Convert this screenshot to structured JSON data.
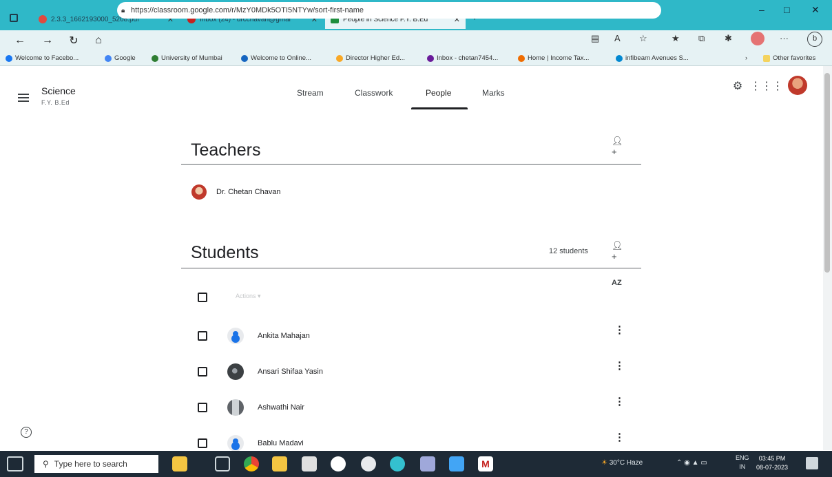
{
  "browser": {
    "tabs": [
      {
        "title": "2.3.3_1662193000_5208.pdf",
        "color": "#e04a3f",
        "active": false
      },
      {
        "title": "Inbox (24) - drcchavan@gmai",
        "color": "#c5221f",
        "active": false
      },
      {
        "title": "People in Science F.Y. B.Ed",
        "color": "#1e8e3e",
        "active": true
      }
    ],
    "new_tab": "+",
    "url": "https://classroom.google.com/r/MzY0MDk5OTI5NTYw/sort-first-name",
    "bookmarks": [
      {
        "label": "Welcome to Facebo...",
        "color": "#1877f2"
      },
      {
        "label": "Google",
        "color": "#4285f4"
      },
      {
        "label": "University of Mumbai",
        "color": "#2e7d32"
      },
      {
        "label": "Welcome to Online...",
        "color": "#1565c0"
      },
      {
        "label": "Director Higher Ed...",
        "color": "#f9a825"
      },
      {
        "label": "Inbox - chetan7454...",
        "color": "#6a1b9a"
      },
      {
        "label": "Home | Income Tax...",
        "color": "#ef6c00"
      },
      {
        "label": "infibeam Avenues S...",
        "color": "#0288d1"
      }
    ],
    "other_favorites": "Other favorites"
  },
  "classroom": {
    "class_name": "Science",
    "class_section": "F.Y. B.Ed",
    "tabs": [
      {
        "label": "Stream",
        "active": false
      },
      {
        "label": "Classwork",
        "active": false
      },
      {
        "label": "People",
        "active": true
      },
      {
        "label": "Marks",
        "active": false
      }
    ]
  },
  "teachers": {
    "title": "Teachers",
    "list": [
      {
        "name": "Dr. Chetan Chavan"
      }
    ]
  },
  "students": {
    "title": "Students",
    "count": "12 students",
    "actions_label": "Actions ▾",
    "sort_label": "AZ",
    "list": [
      {
        "name": "Ankita Mahajan",
        "photo": "default"
      },
      {
        "name": "Ansari Shifaa Yasin",
        "photo": "dark"
      },
      {
        "name": "Ashwathi Nair",
        "photo": "gray"
      },
      {
        "name": "Bablu Madavi",
        "photo": "default"
      }
    ]
  },
  "taskbar": {
    "search_placeholder": "Type here to search",
    "weather": "30°C Haze",
    "lang": "ENG",
    "lang_region": "IN",
    "time": "03:45 PM",
    "date": "08-07-2023"
  }
}
